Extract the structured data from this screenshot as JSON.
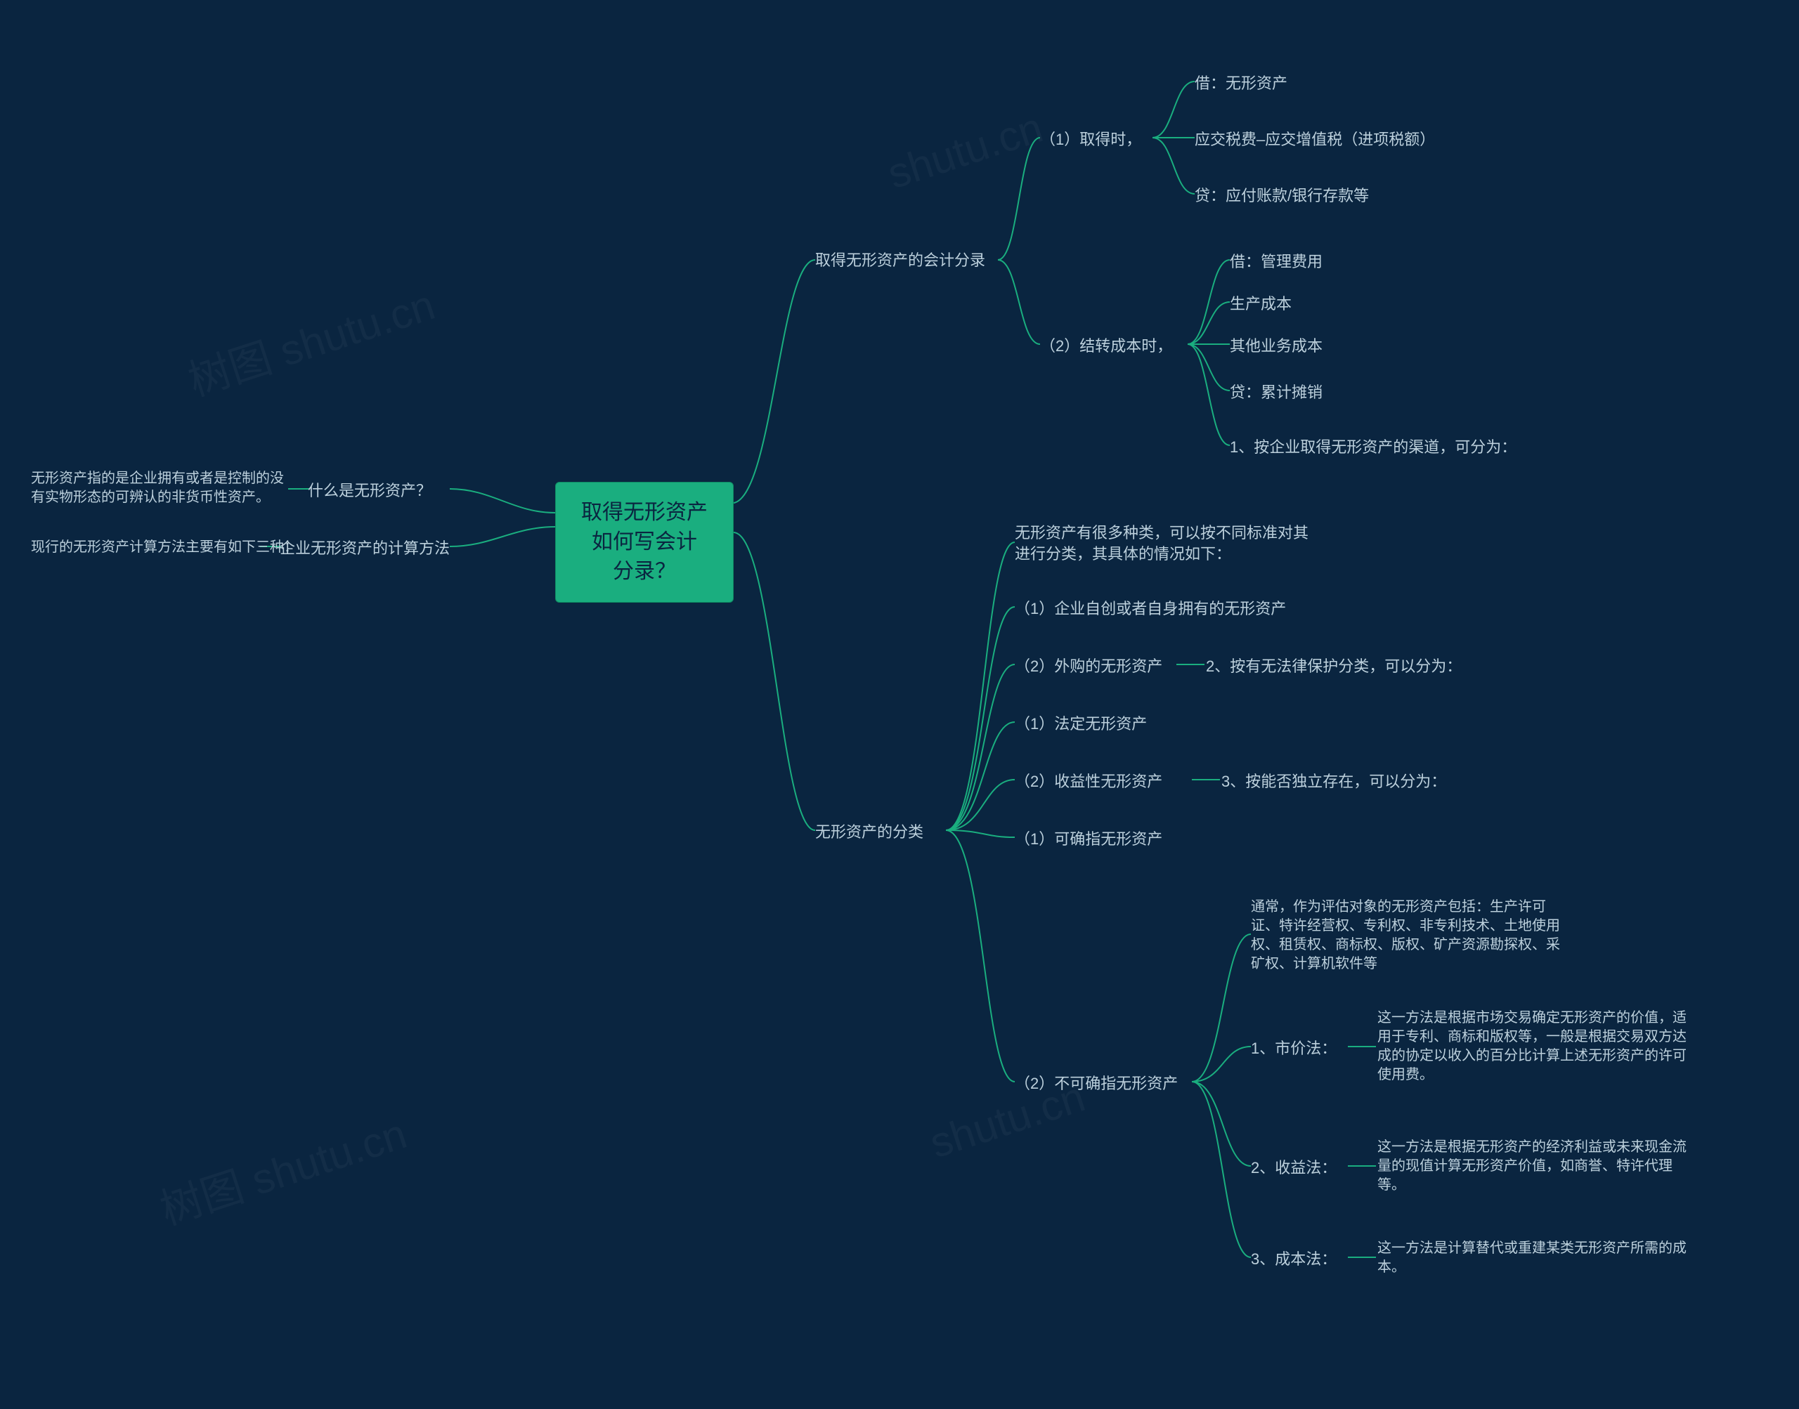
{
  "root": {
    "title_l1": "取得无形资产如何写会计",
    "title_l2": "分录？"
  },
  "left": {
    "q1": {
      "label": "什么是无形资产？",
      "desc": "无形资产指的是企业拥有或者是控制的没有实物形态的可辨认的非货币性资产。"
    },
    "q2": {
      "label": "企业无形资产的计算方法",
      "desc": "现行的无形资产计算方法主要有如下三种："
    }
  },
  "right": {
    "b1": {
      "label": "取得无形资产的会计分录",
      "s1": {
        "label": "（1）取得时，",
        "c1": "借：无形资产",
        "c2": "应交税费–应交增值税（进项税额）",
        "c3": "贷：应付账款/银行存款等"
      },
      "s2": {
        "label": "（2）结转成本时，",
        "c1": "借：管理费用",
        "c2": "生产成本",
        "c3": "其他业务成本",
        "c4": "贷：累计摊销",
        "note": "1、按企业取得无形资产的渠道，可分为："
      }
    },
    "b2": {
      "label": "无形资产的分类",
      "c0": "无形资产有很多种类，可以按不同标准对其进行分类，其具体的情况如下：",
      "c1": "（1）企业自创或者自身拥有的无形资产",
      "c2": {
        "label": "（2）外购的无形资产",
        "note": "2、按有无法律保护分类，可以分为："
      },
      "c3": "（1）法定无形资产",
      "c4": {
        "label": "（2）收益性无形资产",
        "note": "3、按能否独立存在，可以分为："
      },
      "c5": "（1）可确指无形资产",
      "c6": {
        "label": "（2）不可确指无形资产",
        "d0": "通常，作为评估对象的无形资产包括：生产许可证、特许经营权、专利权、非专利技术、土地使用权、租赁权、商标权、版权、矿产资源勘探权、采矿权、计算机软件等",
        "d1": {
          "label": "1、市价法：",
          "desc": "这一方法是根据市场交易确定无形资产的价值，适用于专利、商标和版权等，一般是根据交易双方达成的协定以收入的百分比计算上述无形资产的许可使用费。"
        },
        "d2": {
          "label": "2、收益法：",
          "desc": "这一方法是根据无形资产的经济利益或未来现金流量的现值计算无形资产价值，如商誉、特许代理等。"
        },
        "d3": {
          "label": "3、成本法：",
          "desc": "这一方法是计算替代或重建某类无形资产所需的成本。"
        }
      }
    }
  },
  "watermarks": [
    "树图 shutu.cn",
    "shutu.cn",
    "树图 shutu.cn",
    "shutu.cn"
  ]
}
